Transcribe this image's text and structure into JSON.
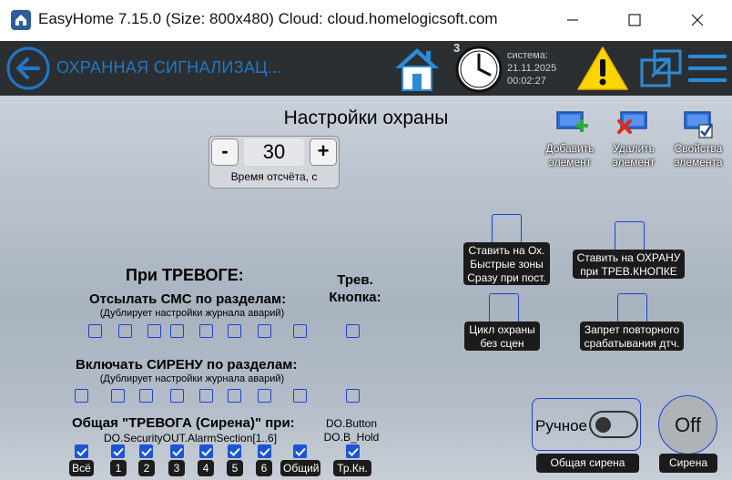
{
  "window": {
    "title": "EasyHome 7.15.0 (Size: 800x480) Cloud: cloud.homelogicsoft.com"
  },
  "header": {
    "title": "ОХРАННАЯ СИГНАЛИЗАЦ...",
    "badge": "3",
    "system_label": "система:",
    "date": "21.11.2025",
    "time": "00:02:27"
  },
  "page": {
    "title": "Настройки охраны"
  },
  "timer": {
    "minus": "-",
    "value": "30",
    "plus": "+",
    "caption": "Время отсчёта, с"
  },
  "toolbar": {
    "add_line1": "Добавить",
    "add_line2": "элемент",
    "del_line1": "Удалить",
    "del_line2": "элемент",
    "props_line1": "Свойства",
    "props_line2": "элемента"
  },
  "options": {
    "arm_quick_1": "Ставить на Ох.",
    "arm_quick_2": "Быстрые зоны",
    "arm_quick_3": "Сразу при пост.",
    "arm_button_1": "Ставить на ОХРАНУ",
    "arm_button_2": "при ТРЕВ.КНОПКЕ",
    "cycle_1": "Цикл охраны",
    "cycle_2": "без сцен",
    "repeat_1": "Запрет повторного",
    "repeat_2": "срабатывания дтч."
  },
  "alarm": {
    "heading": "При ТРЕВОГЕ:",
    "panic_1": "Трев.",
    "panic_2": "Кнопка:",
    "sms_title": "Отсылать СМС по разделам:",
    "sms_note": "(Дублирует настройки журнала аварий)",
    "siren_title": "Включать СИРЕНУ по разделам:",
    "siren_note": "(Дублирует настройки журнала аварий)",
    "general_title": "Общая \"ТРЕВОГА (Сирена)\" при:",
    "general_source": "DO.SecurityOUT.AlarmSection[1..6]",
    "do_button": "DO.Button",
    "do_hold": "DO.B_Hold",
    "labels": [
      "Всё",
      "1",
      "2",
      "3",
      "4",
      "5",
      "6",
      "Общий",
      "Тр.Кн."
    ]
  },
  "siren": {
    "manual_label": "Ручное",
    "manual_caption": "Общая сирена",
    "state": "Off",
    "state_caption": "Сирена"
  },
  "colors": {
    "accent": "#1f43c8",
    "checked": "#1a55d6",
    "header_bg": "#2c2f31",
    "header_title": "#1f78c8"
  }
}
